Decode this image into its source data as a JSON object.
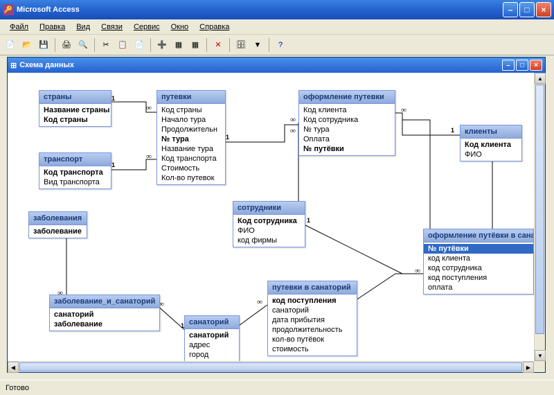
{
  "app": {
    "title": "Microsoft Access"
  },
  "menu": [
    "Файл",
    "Правка",
    "Вид",
    "Связи",
    "Сервис",
    "Окно",
    "Справка"
  ],
  "childWindow": {
    "title": "Схема данных"
  },
  "status": "Готово",
  "tables": {
    "countries": {
      "title": "страны",
      "fields": [
        {
          "n": "Название страны",
          "pk": true
        },
        {
          "n": "Код страны",
          "pk": true
        }
      ]
    },
    "transport": {
      "title": "транспорт",
      "fields": [
        {
          "n": "Код транспорта",
          "pk": true
        },
        {
          "n": "Вид транспорта"
        }
      ]
    },
    "diseases": {
      "title": "заболевания",
      "fields": [
        {
          "n": "заболевание",
          "pk": true
        }
      ]
    },
    "tours": {
      "title": "путевки",
      "fields": [
        {
          "n": "Код страны"
        },
        {
          "n": "Начало тура"
        },
        {
          "n": "Продолжительн"
        },
        {
          "n": "№ тура",
          "pk": true
        },
        {
          "n": "Название тура"
        },
        {
          "n": "Код транспорта"
        },
        {
          "n": "Стоимость"
        },
        {
          "n": "Кол-во путевок"
        }
      ]
    },
    "registration": {
      "title": "оформление путевки",
      "fields": [
        {
          "n": "Код клиента"
        },
        {
          "n": "Код сотрудника"
        },
        {
          "n": "№ тура"
        },
        {
          "n": "Оплата"
        },
        {
          "n": "№ путёвки",
          "pk": true
        }
      ]
    },
    "clients": {
      "title": "клиенты",
      "fields": [
        {
          "n": "Код клиента",
          "pk": true
        },
        {
          "n": "ФИО"
        }
      ]
    },
    "staff": {
      "title": "сотрудники",
      "fields": [
        {
          "n": "Код сотрудника",
          "pk": true
        },
        {
          "n": "ФИО"
        },
        {
          "n": "код фирмы"
        }
      ]
    },
    "disease_san": {
      "title": "заболевание_и_санаторий",
      "fields": [
        {
          "n": "санаторий",
          "pk": true
        },
        {
          "n": "заболевание",
          "pk": true
        }
      ]
    },
    "sanatorium": {
      "title": "санаторий",
      "fields": [
        {
          "n": "санаторий",
          "pk": true
        },
        {
          "n": "адрес"
        },
        {
          "n": "город"
        }
      ]
    },
    "tours_san": {
      "title": "путевки в санаторий",
      "fields": [
        {
          "n": "код поступления",
          "pk": true
        },
        {
          "n": "санаторий"
        },
        {
          "n": "дата прибытия"
        },
        {
          "n": "продолжительность"
        },
        {
          "n": "кол-во путёвок"
        },
        {
          "n": "стоимость"
        }
      ]
    },
    "reg_san": {
      "title": "оформление путёвки в сана...",
      "fields": [
        {
          "n": "№ путёвки",
          "pk": true,
          "sel": true
        },
        {
          "n": "код клиента"
        },
        {
          "n": "код сотрудника"
        },
        {
          "n": "код поступления"
        },
        {
          "n": "оплата"
        }
      ]
    }
  },
  "relationships": [
    {
      "from": "countries",
      "to": "tours",
      "type": "1-∞"
    },
    {
      "from": "transport",
      "to": "tours",
      "type": "1-∞"
    },
    {
      "from": "tours",
      "to": "registration",
      "type": "1-∞"
    },
    {
      "from": "clients",
      "to": "registration",
      "type": "1-∞"
    },
    {
      "from": "staff",
      "to": "registration",
      "type": "1-∞"
    },
    {
      "from": "staff",
      "to": "reg_san",
      "type": "1-∞"
    },
    {
      "from": "clients",
      "to": "reg_san",
      "type": "1-∞"
    },
    {
      "from": "diseases",
      "to": "disease_san",
      "type": "1-∞"
    },
    {
      "from": "sanatorium",
      "to": "disease_san",
      "type": "1-∞"
    },
    {
      "from": "sanatorium",
      "to": "tours_san",
      "type": "1-∞"
    },
    {
      "from": "tours_san",
      "to": "reg_san",
      "type": "1-∞"
    }
  ]
}
